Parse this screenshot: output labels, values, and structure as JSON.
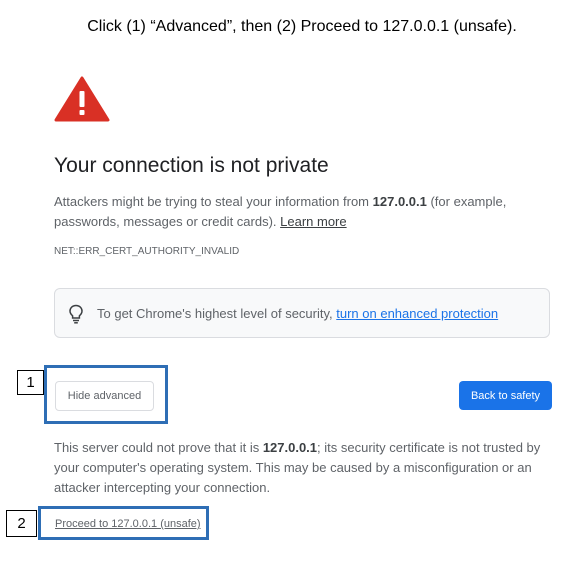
{
  "instruction": "Click (1) “Advanced”, then (2) Proceed to 127.0.0.1 (unsafe).",
  "page": {
    "title": "Your connection is not private",
    "description_prefix": "Attackers might be trying to steal your information from ",
    "host": "127.0.0.1",
    "description_suffix": " (for example, passwords, messages or credit cards). ",
    "learn_more": "Learn more",
    "error_code": "NET::ERR_CERT_AUTHORITY_INVALID",
    "icon": "warning-triangle-icon",
    "accent_color": "#d93025"
  },
  "banner": {
    "icon": "lightbulb-icon",
    "text": "To get Chrome's highest level of security, ",
    "link": "turn on enhanced protection"
  },
  "buttons": {
    "hide_advanced": "Hide advanced",
    "back_to_safety": "Back to safety",
    "primary_color": "#1a73e8"
  },
  "details": {
    "prefix": "This server could not prove that it is ",
    "host": "127.0.0.1",
    "suffix": "; its security certificate is not trusted by your computer's operating system. This may be caused by a misconfiguration or an attacker intercepting your connection.",
    "proceed_link": "Proceed to 127.0.0.1 (unsafe)"
  },
  "annotations": {
    "label_1": "1",
    "label_2": "2",
    "box_color": "#2e6eb5"
  }
}
